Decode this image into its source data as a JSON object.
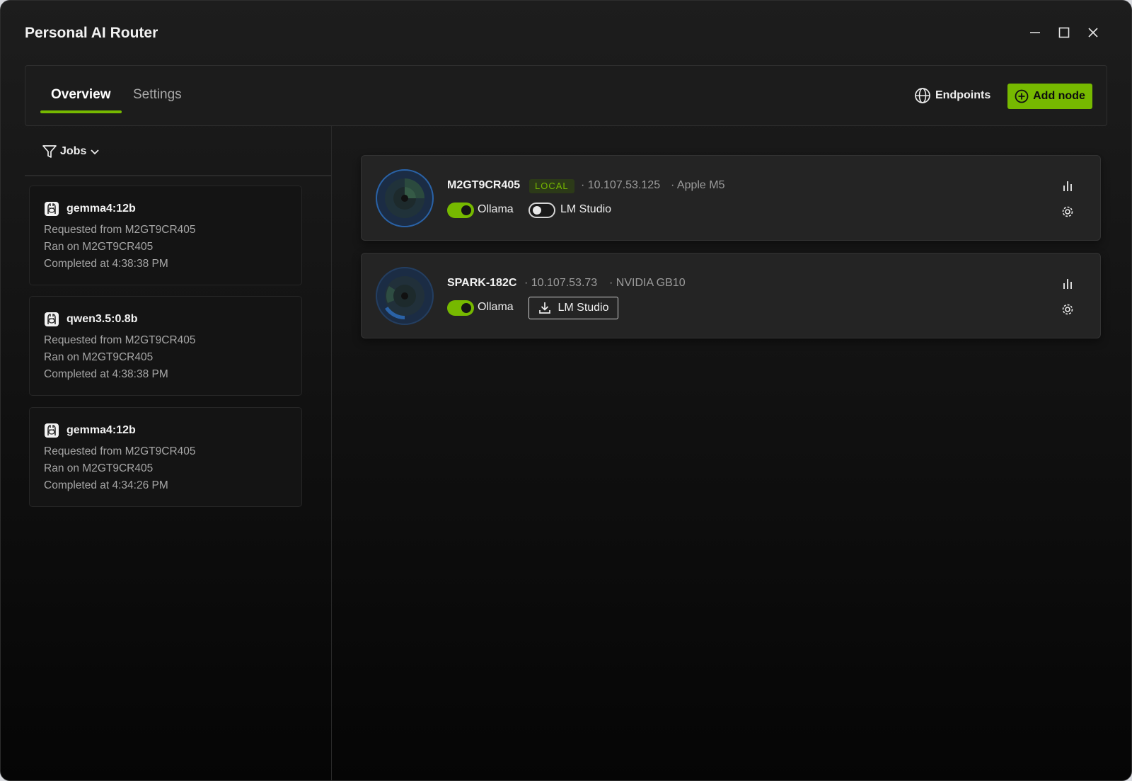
{
  "window": {
    "title": "Personal AI Router",
    "controls": [
      "minimize-icon",
      "maximize-icon",
      "close-icon"
    ]
  },
  "tabs": [
    {
      "label": "Overview",
      "active": true
    },
    {
      "label": "Settings",
      "active": false
    }
  ],
  "toolbar": {
    "endpoints_label": "Endpoints",
    "add_node_label": "Add node"
  },
  "jobs": {
    "filter_label": "Jobs",
    "items": [
      {
        "model": "gemma4:12b",
        "requested": "Requested from M2GT9CR405",
        "ran": "Ran on M2GT9CR405",
        "completed": "Completed at 4:38:38 PM"
      },
      {
        "model": "qwen3.5:0.8b",
        "requested": "Requested from M2GT9CR405",
        "ran": "Ran on M2GT9CR405",
        "completed": "Completed at 4:38:38 PM"
      },
      {
        "model": "gemma4:12b",
        "requested": "Requested from M2GT9CR405",
        "ran": "Ran on M2GT9CR405",
        "completed": "Completed at 4:34:26 PM"
      }
    ]
  },
  "nodes": [
    {
      "name": "M2GT9CR405",
      "badge": "LOCAL",
      "ip": "· 10.107.53.125",
      "hardware": "· Apple M5",
      "ollama": {
        "label": "Ollama",
        "enabled": true
      },
      "lmstudio": {
        "label": "LM Studio",
        "enabled": false
      }
    },
    {
      "name": "SPARK-182C",
      "ip": "· 10.107.53.73",
      "hardware": "· NVIDIA GB10",
      "ollama": {
        "label": "Ollama",
        "enabled": true
      },
      "lmstudio": {
        "label": "LM Studio",
        "action": "install"
      }
    }
  ],
  "colors": {
    "accent": "#76b900",
    "background": "#141414",
    "card": "#242424"
  }
}
